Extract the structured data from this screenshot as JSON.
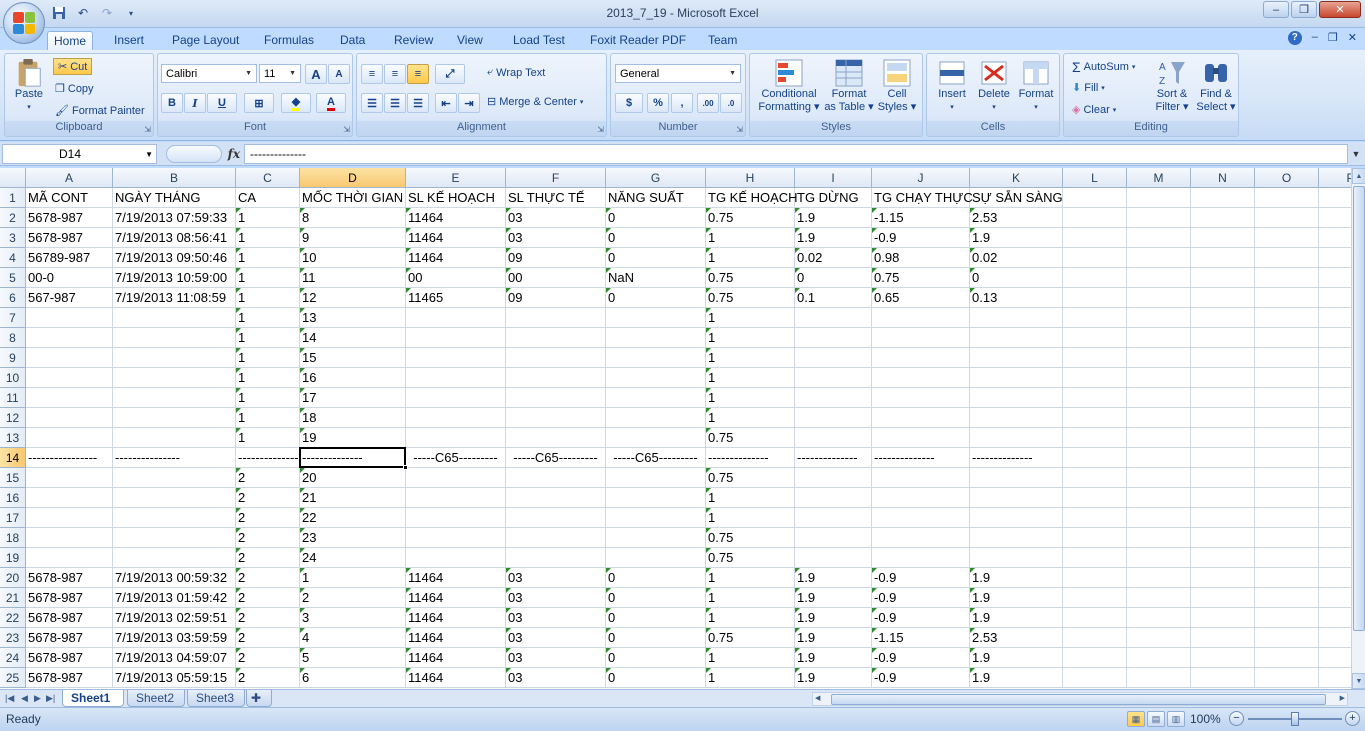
{
  "window": {
    "title": "2013_7_19 - Microsoft Excel",
    "minimize_glyph": "–",
    "restore_glyph": "❐",
    "close_glyph": "✕"
  },
  "qat": {
    "save_icon": "save-icon",
    "undo_icon": "undo-icon",
    "redo_icon": "redo-icon"
  },
  "tabs": [
    "Home",
    "Insert",
    "Page Layout",
    "Formulas",
    "Data",
    "Review",
    "View",
    "Load Test",
    "Foxit Reader PDF",
    "Team"
  ],
  "active_tab": "Home",
  "ribbon": {
    "clipboard": {
      "label": "Clipboard",
      "paste": "Paste",
      "cut": "Cut",
      "copy": "Copy",
      "format_painter": "Format Painter"
    },
    "font": {
      "label": "Font",
      "name": "Calibri",
      "size": "11",
      "bold": "B",
      "italic": "I",
      "underline": "U",
      "grow": "A",
      "shrink": "A"
    },
    "alignment": {
      "label": "Alignment",
      "wrap": "Wrap Text",
      "merge": "Merge & Center"
    },
    "number": {
      "label": "Number",
      "format": "General",
      "currency": "$",
      "percent": "%",
      "comma": ",",
      "inc_dec": ".00",
      "dec_dec": ".0"
    },
    "styles": {
      "label": "Styles",
      "conditional": [
        "Conditional",
        "Formatting ▾"
      ],
      "format_table": [
        "Format",
        "as Table ▾"
      ],
      "cell_styles": [
        "Cell",
        "Styles ▾"
      ]
    },
    "cells": {
      "label": "Cells",
      "insert": "Insert",
      "delete": "Delete",
      "format": "Format"
    },
    "editing": {
      "label": "Editing",
      "autosum": "AutoSum",
      "fill": "Fill",
      "clear": "Clear",
      "sort": [
        "Sort &",
        "Filter ▾"
      ],
      "find": [
        "Find &",
        "Select ▾"
      ]
    }
  },
  "formula_bar": {
    "name_box": "D14",
    "fx": "fx",
    "content": "--------------"
  },
  "columns": [
    {
      "letter": "A"
    },
    {
      "letter": "B"
    },
    {
      "letter": "C"
    },
    {
      "letter": "D"
    },
    {
      "letter": "E"
    },
    {
      "letter": "F"
    },
    {
      "letter": "G"
    },
    {
      "letter": "H"
    },
    {
      "letter": "I"
    },
    {
      "letter": "J"
    },
    {
      "letter": "K"
    },
    {
      "letter": "L"
    },
    {
      "letter": "M"
    },
    {
      "letter": "N"
    },
    {
      "letter": "O"
    },
    {
      "letter": "P"
    }
  ],
  "selected_cell": {
    "col": "D",
    "row": 14
  },
  "rows": [
    {
      "n": 1,
      "cells": [
        "MÃ CONT",
        "NGÀY THÁNG",
        "CA",
        "MỐC THỜI GIAN",
        "SL KẾ HOẠCH",
        "SL THỰC TẾ",
        "NĂNG SUẤT",
        "TG KẾ HOẠCH",
        "TG DỪNG",
        "TG CHẠY THỰC",
        "SỰ SẴN SÀNG"
      ]
    },
    {
      "n": 2,
      "cells": [
        "5678-987",
        "7/19/2013 07:59:33",
        "1",
        "8",
        "11464",
        "03",
        "0",
        "0.75",
        "1.9",
        "-1.15",
        "2.53"
      ]
    },
    {
      "n": 3,
      "cells": [
        "5678-987",
        "7/19/2013 08:56:41",
        "1",
        "9",
        "11464",
        "03",
        "0",
        "1",
        "1.9",
        "-0.9",
        "1.9"
      ]
    },
    {
      "n": 4,
      "cells": [
        "56789-987",
        "7/19/2013 09:50:46",
        "1",
        "10",
        "11464",
        "09",
        "0",
        "1",
        "0.02",
        "0.98",
        "0.02"
      ]
    },
    {
      "n": 5,
      "cells": [
        "00-0",
        "7/19/2013 10:59:00",
        "1",
        "11",
        "00",
        "00",
        "NaN",
        "0.75",
        "0",
        "0.75",
        "0"
      ]
    },
    {
      "n": 6,
      "cells": [
        "567-987",
        "7/19/2013 11:08:59",
        "1",
        "12",
        "11465",
        "09",
        "0",
        "0.75",
        "0.1",
        "0.65",
        "0.13"
      ]
    },
    {
      "n": 7,
      "cells": [
        "",
        "",
        "1",
        "13",
        "",
        "",
        "",
        "1",
        "",
        "",
        ""
      ]
    },
    {
      "n": 8,
      "cells": [
        "",
        "",
        "1",
        "14",
        "",
        "",
        "",
        "1",
        "",
        "",
        ""
      ]
    },
    {
      "n": 9,
      "cells": [
        "",
        "",
        "1",
        "15",
        "",
        "",
        "",
        "1",
        "",
        "",
        ""
      ]
    },
    {
      "n": 10,
      "cells": [
        "",
        "",
        "1",
        "16",
        "",
        "",
        "",
        "1",
        "",
        "",
        ""
      ]
    },
    {
      "n": 11,
      "cells": [
        "",
        "",
        "1",
        "17",
        "",
        "",
        "",
        "1",
        "",
        "",
        ""
      ]
    },
    {
      "n": 12,
      "cells": [
        "",
        "",
        "1",
        "18",
        "",
        "",
        "",
        "1",
        "",
        "",
        ""
      ]
    },
    {
      "n": 13,
      "cells": [
        "",
        "",
        "1",
        "19",
        "",
        "",
        "",
        "0.75",
        "",
        "",
        ""
      ]
    },
    {
      "n": 14,
      "cells": [
        "----------------",
        "---------------",
        "--------------",
        "--------------",
        "-----C65---------",
        "-----C65---------",
        "-----C65---------",
        "--------------",
        "--------------",
        "--------------",
        "--------------"
      ]
    },
    {
      "n": 15,
      "cells": [
        "",
        "",
        "2",
        "20",
        "",
        "",
        "",
        "0.75",
        "",
        "",
        ""
      ]
    },
    {
      "n": 16,
      "cells": [
        "",
        "",
        "2",
        "21",
        "",
        "",
        "",
        "1",
        "",
        "",
        ""
      ]
    },
    {
      "n": 17,
      "cells": [
        "",
        "",
        "2",
        "22",
        "",
        "",
        "",
        "1",
        "",
        "",
        ""
      ]
    },
    {
      "n": 18,
      "cells": [
        "",
        "",
        "2",
        "23",
        "",
        "",
        "",
        "0.75",
        "",
        "",
        ""
      ]
    },
    {
      "n": 19,
      "cells": [
        "",
        "",
        "2",
        "24",
        "",
        "",
        "",
        "0.75",
        "",
        "",
        ""
      ]
    },
    {
      "n": 20,
      "cells": [
        "5678-987",
        "7/19/2013 00:59:32",
        "2",
        "1",
        "11464",
        "03",
        "0",
        "1",
        "1.9",
        "-0.9",
        "1.9"
      ]
    },
    {
      "n": 21,
      "cells": [
        "5678-987",
        "7/19/2013 01:59:42",
        "2",
        "2",
        "11464",
        "03",
        "0",
        "1",
        "1.9",
        "-0.9",
        "1.9"
      ]
    },
    {
      "n": 22,
      "cells": [
        "5678-987",
        "7/19/2013 02:59:51",
        "2",
        "3",
        "11464",
        "03",
        "0",
        "1",
        "1.9",
        "-0.9",
        "1.9"
      ]
    },
    {
      "n": 23,
      "cells": [
        "5678-987",
        "7/19/2013 03:59:59",
        "2",
        "4",
        "11464",
        "03",
        "0",
        "0.75",
        "1.9",
        "-1.15",
        "2.53"
      ]
    },
    {
      "n": 24,
      "cells": [
        "5678-987",
        "7/19/2013 04:59:07",
        "2",
        "5",
        "11464",
        "03",
        "0",
        "1",
        "1.9",
        "-0.9",
        "1.9"
      ]
    },
    {
      "n": 25,
      "cells": [
        "5678-987",
        "7/19/2013 05:59:15",
        "2",
        "6",
        "11464",
        "03",
        "0",
        "1",
        "1.9",
        "-0.9",
        "1.9"
      ]
    }
  ],
  "sheets": [
    "Sheet1",
    "Sheet2",
    "Sheet3"
  ],
  "active_sheet": "Sheet1",
  "status": {
    "text": "Ready",
    "zoom": "100%",
    "zoom_fraction": 0.5
  },
  "colors": {
    "accent": "#15428b",
    "selection_header": "#f8c871",
    "error_triangle": "#2e8b2e"
  }
}
